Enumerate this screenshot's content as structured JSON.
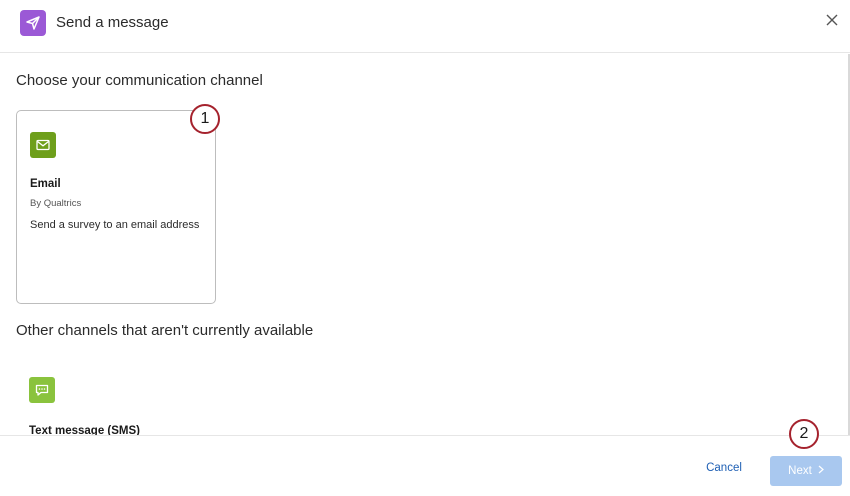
{
  "header": {
    "title": "Send a message",
    "icon": "paper-plane-icon",
    "close_icon": "close-icon",
    "accent": "#9b59d6"
  },
  "main": {
    "section_title": "Choose your communication channel",
    "channels": [
      {
        "name": "Email",
        "vendor": "By Qualtrics",
        "description": "Send a survey to an email address",
        "icon": "envelope-icon",
        "icon_color": "#6e9f1b"
      }
    ],
    "unavailable_title": "Other channels that aren't currently available",
    "unavailable_channels": [
      {
        "name": "Text message (SMS)",
        "icon": "chat-bubble-icon",
        "icon_color": "#8ac33d"
      }
    ]
  },
  "callouts": [
    "1",
    "2"
  ],
  "footer": {
    "cancel_label": "Cancel",
    "next_label": "Next",
    "next_color": "#a9c8ef",
    "cancel_color": "#1e5fb4"
  }
}
